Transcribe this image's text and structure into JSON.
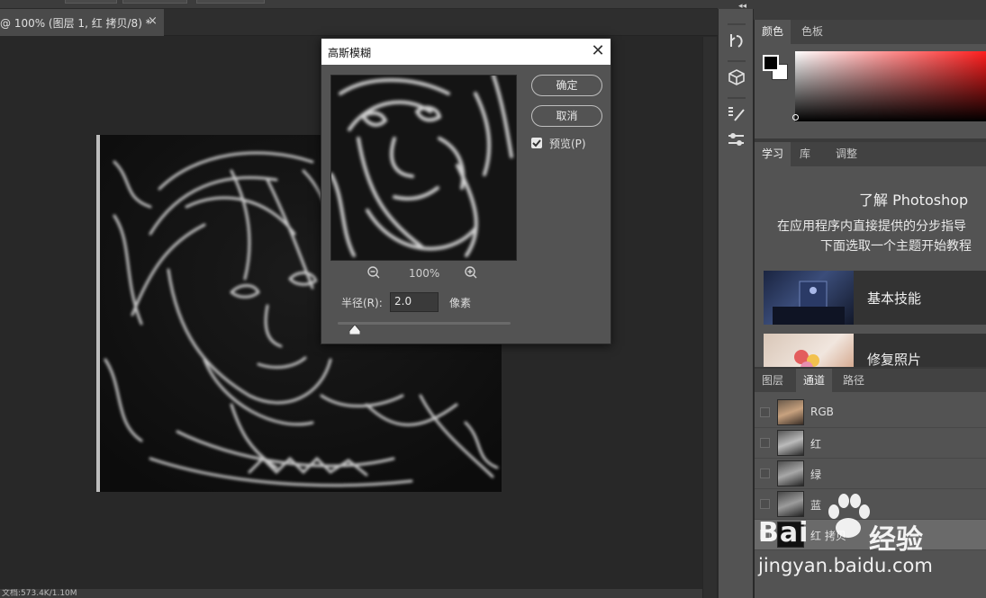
{
  "document_tab": {
    "title": "@ 100% (图层 1, 红 拷贝/8) *",
    "close_glyph": "×"
  },
  "status_bar": {
    "doc_info": "文档:573.4K/1.10M"
  },
  "dialog": {
    "title": "高斯模糊",
    "ok_label": "确定",
    "cancel_label": "取消",
    "preview_label": "预览(P)",
    "preview_checked": true,
    "zoom_level": "100%",
    "radius_label": "半径(R):",
    "radius_value": "2.0",
    "unit_label": "像素",
    "slider_fraction": 0.1
  },
  "color_panel": {
    "tabs": [
      "颜色",
      "色板"
    ],
    "foreground_color": "#000000",
    "background_color": "#ffffff",
    "hue_color": "#ff1e1e"
  },
  "learn_panel": {
    "tabs": [
      "学习",
      "库",
      "调整"
    ],
    "heading": "了解 Photoshop",
    "desc_line1": "在应用程序内直接提供的分步指导",
    "desc_line2": "下面选取一个主题开始教程",
    "cards": [
      {
        "label": "基本技能"
      },
      {
        "label": "修复照片"
      }
    ]
  },
  "channels_panel": {
    "tabs": [
      "图层",
      "通道",
      "路径"
    ],
    "channels": [
      {
        "label": "RGB"
      },
      {
        "label": "红"
      },
      {
        "label": "绿"
      },
      {
        "label": "蓝"
      },
      {
        "label": "红 拷贝"
      }
    ]
  },
  "watermark": {
    "brand": "Bai",
    "brand_suffix": "经验",
    "url": "jingyan.baidu.com"
  },
  "icons": [
    "history-icon",
    "3d-icon",
    "brush-settings-icon",
    "properties-icon",
    "zoom-out-icon",
    "zoom-in-icon",
    "close-icon",
    "eye-icon"
  ]
}
